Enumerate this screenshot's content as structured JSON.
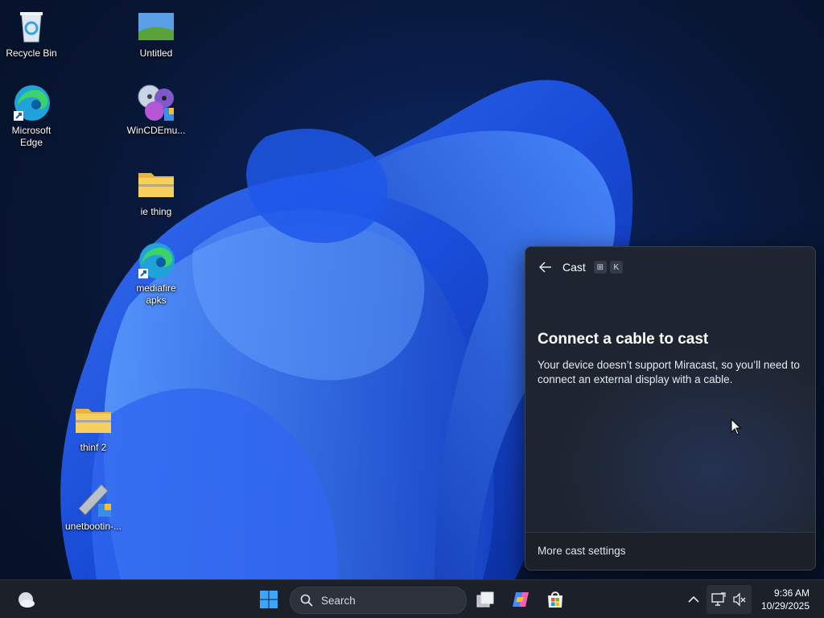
{
  "desktop": {
    "icons": [
      {
        "label": "Recycle Bin"
      },
      {
        "label": "Untitled"
      },
      {
        "label": "Microsoft Edge"
      },
      {
        "label": "WinCDEmu..."
      },
      {
        "label": "ie thing"
      },
      {
        "label": "mediafire apks"
      },
      {
        "label": "thinf 2"
      },
      {
        "label": "unetbootin-..."
      }
    ]
  },
  "cast_panel": {
    "title": "Cast",
    "shortcut_keys": [
      "⊞",
      "K"
    ],
    "heading": "Connect a cable to cast",
    "message": "Your device doesn’t support Miracast, so you’ll need to connect an external display with a cable.",
    "footer_link": "More cast settings"
  },
  "taskbar": {
    "search_placeholder": "Search",
    "clock_time": "9:36 AM",
    "clock_date": "10/29/2025"
  },
  "colors": {
    "accent": "#2a6ff0",
    "panel_bg": "#1f2530",
    "taskbar_bg": "#1c2028"
  }
}
